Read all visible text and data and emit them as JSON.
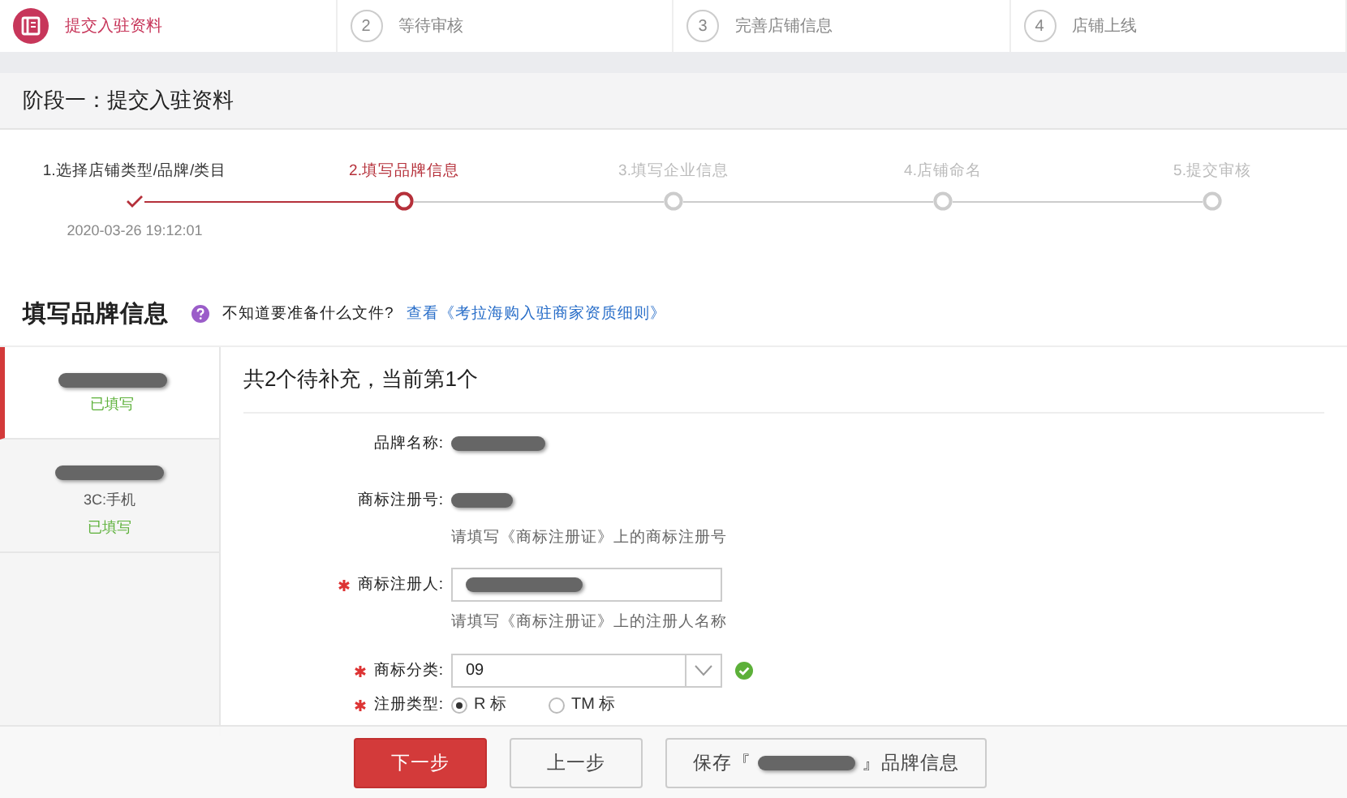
{
  "top_steps": [
    {
      "label": "提交入驻资料",
      "selected": true
    },
    {
      "number": "2",
      "label": "等待审核",
      "selected": false
    },
    {
      "number": "3",
      "label": "完善店铺信息",
      "selected": false
    },
    {
      "number": "4",
      "label": "店铺上线",
      "selected": false
    }
  ],
  "stage_title": "阶段一：提交入驻资料",
  "progress": {
    "steps": [
      {
        "label": "1.选择店铺类型/品牌/类目",
        "done": true,
        "selected": false,
        "date": "2020-03-26 19:12:01"
      },
      {
        "label": "2.填写品牌信息",
        "done": false,
        "selected": true
      },
      {
        "label": "3.填写企业信息",
        "done": false,
        "selected": false
      },
      {
        "label": "4.店铺命名",
        "done": false,
        "selected": false
      },
      {
        "label": "5.提交审核",
        "done": false,
        "selected": false
      }
    ]
  },
  "section": {
    "title": "填写品牌信息",
    "help_text": "不知道要准备什么文件?",
    "link": "查看《考拉海购入驻商家资质细则》"
  },
  "sidebar": {
    "items": [
      {
        "status": "已填写",
        "selected": true
      },
      {
        "category": "3C:手机",
        "status": "已填写",
        "selected": false
      }
    ]
  },
  "form": {
    "title": "共2个待补充，当前第1个",
    "fields": [
      {
        "kind": "static",
        "label": "品牌名称:"
      },
      {
        "kind": "static",
        "label": "商标注册号:",
        "hint": "请填写《商标注册证》上的商标注册号"
      },
      {
        "kind": "input",
        "label": "商标注册人:",
        "required": true,
        "hint": "请填写《商标注册证》上的注册人名称"
      },
      {
        "kind": "select",
        "label": "商标分类:",
        "required": true,
        "value": "09",
        "valid": true
      },
      {
        "kind": "radio",
        "label": "注册类型:",
        "required": true,
        "options": [
          {
            "label": "R 标",
            "selected": true
          },
          {
            "label": "TM 标",
            "selected": false
          }
        ]
      }
    ]
  },
  "footer": {
    "buttons": [
      {
        "kind": "primary",
        "label": "下一步"
      },
      {
        "kind": "default",
        "label": "上一步"
      },
      {
        "kind": "save",
        "prefix": "保存『",
        "suffix": "』品牌信息"
      }
    ]
  }
}
